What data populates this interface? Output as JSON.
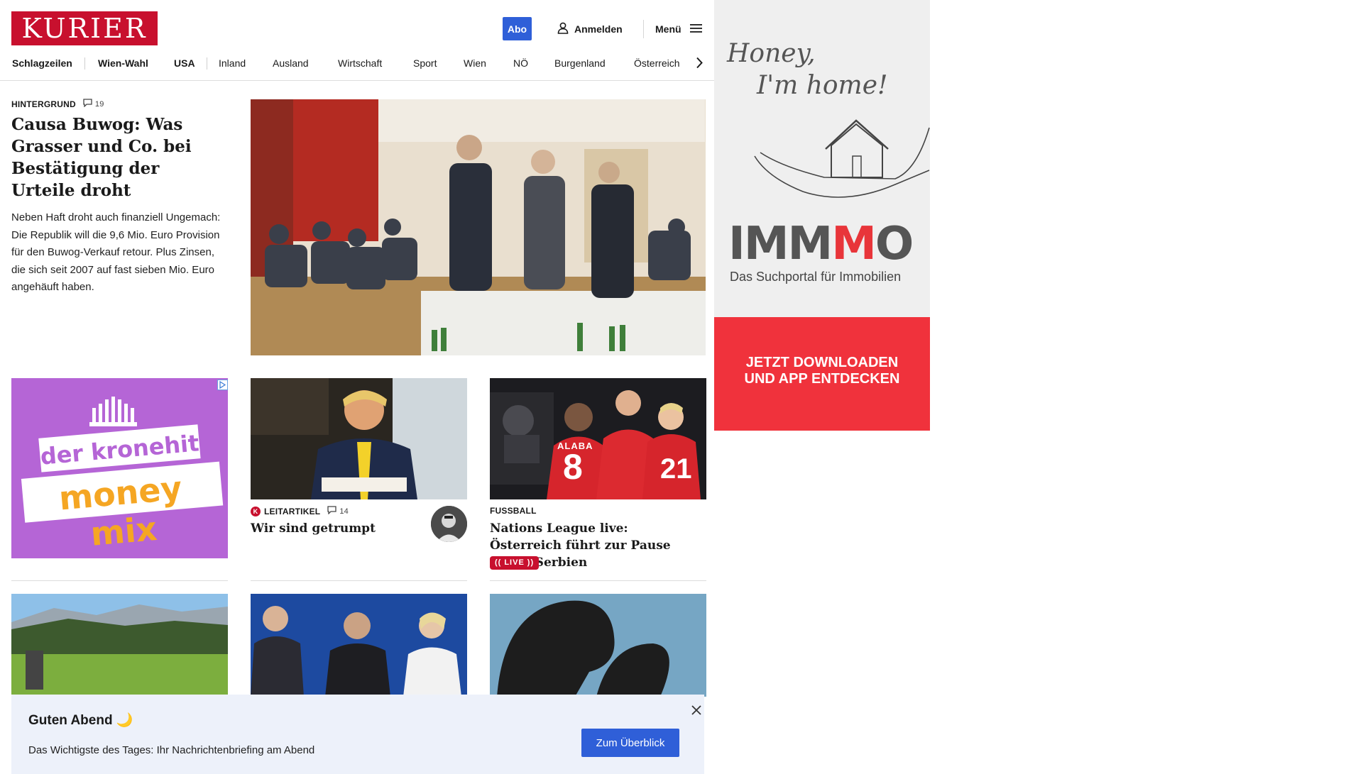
{
  "brand": {
    "logo_text": "KURIER",
    "accent": "#c8102e",
    "button_blue": "#2f5fd8"
  },
  "header": {
    "abo_label": "Abo",
    "login_label": "Anmelden",
    "login_icon": "user-icon",
    "menu_label": "Menü",
    "menu_icon": "hamburger-icon"
  },
  "nav": {
    "items": [
      "Schlagzeilen",
      "Wien-Wahl",
      "USA",
      "Inland",
      "Ausland",
      "Wirtschaft",
      "Sport",
      "Wien",
      "NÖ",
      "Burgenland",
      "Österreich"
    ],
    "next_icon": "chevron-right-icon"
  },
  "lead": {
    "kicker": "HINTERGRUND",
    "comments": "19",
    "title": "Causa Buwog: Was Grasser und Co. bei Bestätigung der Urteile droht",
    "teaser": "Neben Haft droht auch finanziell Ungemach: Die Republik will die 9,6 Mio. Euro Provision für den Buwog-Verkauf retour. Plus Zinsen, die sich seit 2007 auf fast sieben Mio. Euro angehäuft haben."
  },
  "ad_kronehit": {
    "line1": "der kronehit",
    "line2": "money mix",
    "bg": "#b565d6"
  },
  "card_leitartikel": {
    "badge": "K",
    "kicker": "LEITARTIKEL",
    "comments": "14",
    "title": "Wir sind getrumpt"
  },
  "card_fussball": {
    "kicker": "FUSSBALL",
    "title": "Nations League live: Österreich führt zur Pause gegen Serbien",
    "live_label": "LIVE",
    "jersey_name": "ALABA",
    "jersey_number_left": "8",
    "jersey_number_right": "21"
  },
  "ad_immmo": {
    "script_line1": "Honey,",
    "script_line2": "I'm home!",
    "brand_imm": "IMM",
    "brand_m": "M",
    "brand_o": "O",
    "subtitle": "Das Suchportal für Immobilien",
    "cta_line1": "JETZT DOWNLOADEN",
    "cta_line2": "UND APP ENTDECKEN",
    "cta_bg": "#f0323c"
  },
  "briefing": {
    "title": "Guten Abend 🌙",
    "text": "Das Wichtigste des Tages: Ihr Nachrichtenbriefing am Abend",
    "button": "Zum Überblick",
    "close_icon": "close-icon"
  }
}
